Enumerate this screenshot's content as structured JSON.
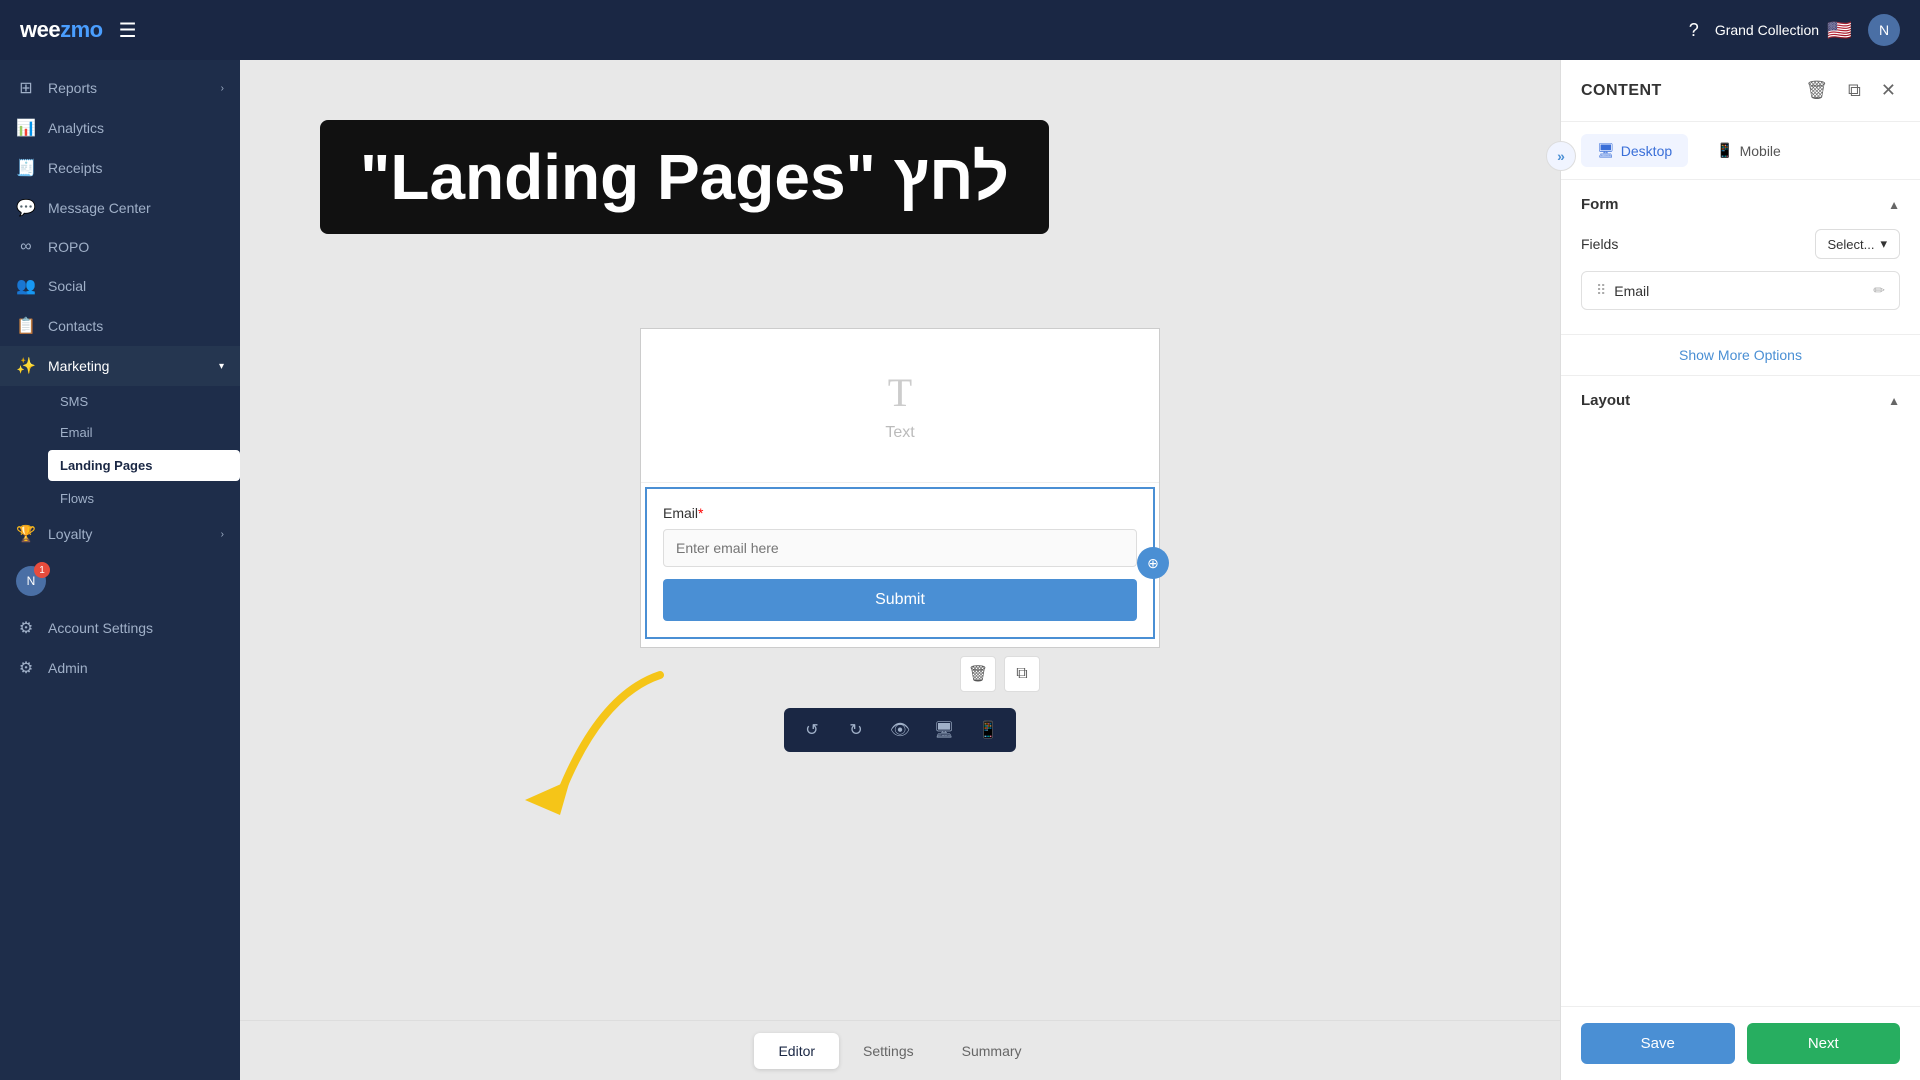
{
  "topbar": {
    "logo_text": "weezmo",
    "menu_icon": "☰",
    "help_icon": "?",
    "org_name": "Grand Collection",
    "flag": "🇺🇸",
    "avatar_letter": "N"
  },
  "sidebar": {
    "items": [
      {
        "id": "reports",
        "label": "Reports",
        "icon": "⊞",
        "has_arrow": true
      },
      {
        "id": "analytics",
        "label": "Analytics",
        "icon": "📊",
        "has_arrow": false
      },
      {
        "id": "receipts",
        "label": "Receipts",
        "icon": "🧾",
        "has_arrow": false
      },
      {
        "id": "message-center",
        "label": "Message Center",
        "icon": "💬",
        "has_arrow": false
      },
      {
        "id": "ropo",
        "label": "ROPO",
        "icon": "∞",
        "has_arrow": false
      },
      {
        "id": "social",
        "label": "Social",
        "icon": "👥",
        "has_arrow": false
      },
      {
        "id": "contacts",
        "label": "Contacts",
        "icon": "📋",
        "has_arrow": false
      },
      {
        "id": "marketing",
        "label": "Marketing",
        "icon": "✨",
        "has_arrow": true,
        "expanded": true
      }
    ],
    "marketing_subitems": [
      {
        "id": "sms",
        "label": "SMS"
      },
      {
        "id": "email",
        "label": "Email"
      },
      {
        "id": "landing-pages",
        "label": "Landing Pages",
        "active": true
      },
      {
        "id": "flows",
        "label": "Flows"
      }
    ],
    "bottom_items": [
      {
        "id": "loyalty",
        "label": "Loyalty",
        "icon": "🏆",
        "has_arrow": true
      },
      {
        "id": "account-settings",
        "label": "Account Settings",
        "icon": "⚙",
        "has_arrow": false
      },
      {
        "id": "admin",
        "label": "Admin",
        "icon": "⚙",
        "has_arrow": false
      }
    ],
    "user_avatar": "N",
    "user_badge": "1"
  },
  "canvas": {
    "text_block_icon": "T",
    "text_block_label": "Text",
    "form_email_label": "Email",
    "form_required_mark": "*",
    "form_placeholder": "Enter email here",
    "form_submit_label": "Submit",
    "drag_icon": "⊕"
  },
  "canvas_toolbar": {
    "tools": [
      {
        "id": "undo",
        "icon": "↺"
      },
      {
        "id": "redo",
        "icon": "↻"
      },
      {
        "id": "preview",
        "icon": "👁"
      },
      {
        "id": "desktop",
        "icon": "🖥"
      },
      {
        "id": "mobile",
        "icon": "📱"
      }
    ]
  },
  "bottom_tabs": [
    {
      "id": "editor",
      "label": "Editor",
      "active": true
    },
    {
      "id": "settings",
      "label": "Settings",
      "active": false
    },
    {
      "id": "summary",
      "label": "Summary",
      "active": false
    }
  ],
  "right_panel": {
    "title": "CONTENT",
    "delete_icon": "🗑",
    "copy_icon": "⧉",
    "close_icon": "✕",
    "desktop_label": "Desktop",
    "mobile_label": "Mobile",
    "form_section_title": "Form",
    "fields_label": "Fields",
    "fields_select_placeholder": "Select...",
    "fields": [
      {
        "id": "email",
        "label": "Email"
      }
    ],
    "show_more_label": "Show More Options",
    "layout_section_title": "Layout",
    "expand_icon": "»",
    "save_label": "Save",
    "next_label": "Next"
  },
  "annotation": {
    "text": "\"Landing Pages\" לחץ"
  }
}
